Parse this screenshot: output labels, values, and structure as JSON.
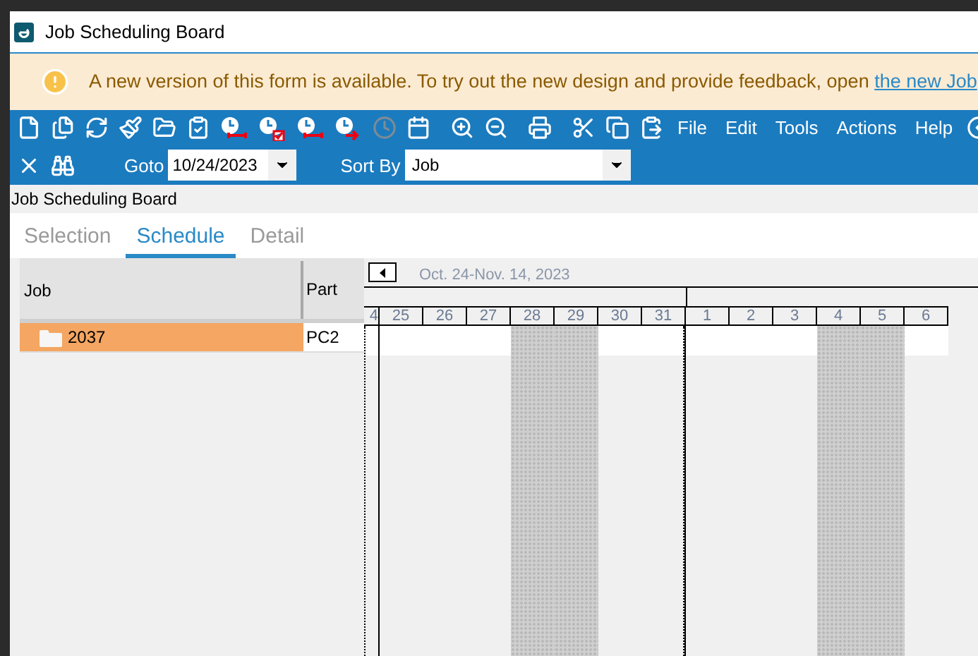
{
  "window": {
    "title": "Job Scheduling Board"
  },
  "banner": {
    "text": "A new version of this form is available. To try out the new design and provide feedback, open ",
    "link": "the new Job"
  },
  "menu": [
    "File",
    "Edit",
    "Tools",
    "Actions",
    "Help"
  ],
  "goto": {
    "label": "Goto",
    "value": "10/24/2023"
  },
  "sort_by": {
    "label": "Sort By",
    "value": "Job"
  },
  "form_title": "Job Scheduling Board",
  "tabs": [
    {
      "label": "Selection",
      "selected": false
    },
    {
      "label": "Schedule",
      "selected": true
    },
    {
      "label": "Detail",
      "selected": false
    }
  ],
  "table": {
    "columns": [
      "Job",
      "Part"
    ],
    "rows": [
      {
        "job": "2037",
        "part": "PC2",
        "selected": true
      }
    ]
  },
  "gantt": {
    "range": "Oct. 24-Nov. 14, 2023",
    "days": [
      {
        "label": "4",
        "weekend": false,
        "partial": true,
        "month_end": false
      },
      {
        "label": "25",
        "weekend": false,
        "partial": false,
        "month_end": false
      },
      {
        "label": "26",
        "weekend": false,
        "partial": false,
        "month_end": false
      },
      {
        "label": "27",
        "weekend": false,
        "partial": false,
        "month_end": false
      },
      {
        "label": "28",
        "weekend": true,
        "partial": false,
        "month_end": false
      },
      {
        "label": "29",
        "weekend": true,
        "partial": false,
        "month_end": false
      },
      {
        "label": "30",
        "weekend": false,
        "partial": false,
        "month_end": false
      },
      {
        "label": "31",
        "weekend": false,
        "partial": false,
        "month_end": true
      },
      {
        "label": "1",
        "weekend": false,
        "partial": false,
        "month_end": false
      },
      {
        "label": "2",
        "weekend": false,
        "partial": false,
        "month_end": false
      },
      {
        "label": "3",
        "weekend": false,
        "partial": false,
        "month_end": false
      },
      {
        "label": "4",
        "weekend": true,
        "partial": false,
        "month_end": false
      },
      {
        "label": "5",
        "weekend": true,
        "partial": false,
        "month_end": false
      },
      {
        "label": "6",
        "weekend": false,
        "partial": false,
        "month_end": false
      }
    ]
  }
}
